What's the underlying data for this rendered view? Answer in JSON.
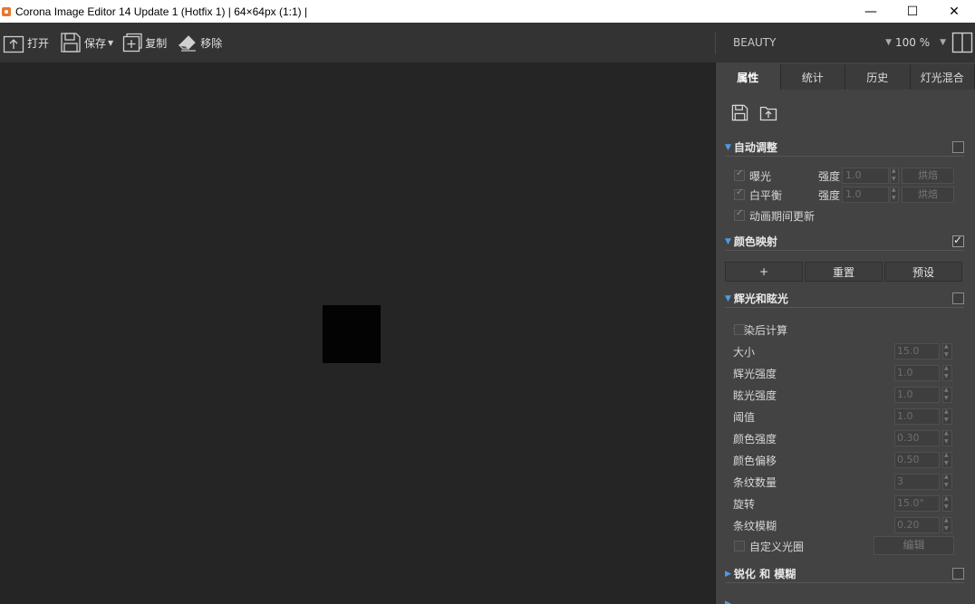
{
  "window": {
    "title": "Corona Image Editor 14 Update 1 (Hotfix 1) | 64×64px (1:1) |",
    "minimize": "—",
    "maximize": "☐",
    "close": "✕"
  },
  "toolbar": {
    "open_label": "打开",
    "save_label": "保存",
    "copy_label": "复制",
    "remove_label": "移除",
    "pass_select": "BEAUTY",
    "zoom_select": "100 %"
  },
  "tabs": [
    "属性",
    "统计",
    "历史",
    "灯光混合"
  ],
  "auto_adjust": {
    "title": "自动调整",
    "enabled": false,
    "exposure_label": "曝光",
    "exposure_checked": true,
    "white_balance_label": "白平衡",
    "white_balance_checked": true,
    "intensity_label": "强度",
    "exposure_intensity": "1.0",
    "white_balance_intensity": "1.0",
    "bake_label": "烘焙",
    "update_during_animation_label": "动画期间更新",
    "update_during_animation_checked": true
  },
  "color_mapping": {
    "title": "颜色映射",
    "enabled": true,
    "add_label": "+",
    "reset_label": "重置",
    "preset_label": "预设"
  },
  "bloom_glare": {
    "title": "辉光和眩光",
    "enabled": false,
    "compute_after_render_label": "渲染后计算",
    "compute_after_render_checked": false,
    "params": [
      {
        "label": "大小",
        "value": "15.0"
      },
      {
        "label": "辉光强度",
        "value": "1.0"
      },
      {
        "label": "眩光强度",
        "value": "1.0"
      },
      {
        "label": "阈值",
        "value": "1.0"
      },
      {
        "label": "颜色强度",
        "value": "0.30"
      },
      {
        "label": "颜色偏移",
        "value": "0.50"
      },
      {
        "label": "条纹数量",
        "value": "3"
      },
      {
        "label": "旋转",
        "value": "15.0°"
      },
      {
        "label": "条纹模糊",
        "value": "0.20"
      }
    ],
    "custom_aperture_label": "自定义光圈",
    "custom_aperture_checked": false,
    "edit_label": "编辑"
  },
  "sharpen_blur": {
    "title": "锐化 和 模糊",
    "enabled": false
  },
  "colors": {
    "accent_triangle": "#4e9be8",
    "panel_bg": "#434343",
    "canvas_bg": "#252525",
    "toolbar_bg": "#333333",
    "app_icon": "#e8772e"
  }
}
